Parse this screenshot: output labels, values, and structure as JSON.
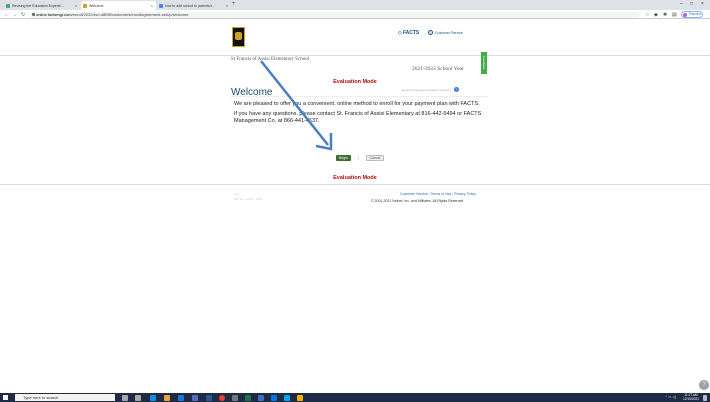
{
  "browser": {
    "tabs": [
      {
        "title": "Revising the Education Experie..."
      },
      {
        "title": "Welcome"
      },
      {
        "title": "how to add school to parents/r..."
      }
    ],
    "url_domain": "online.factsmgt.com",
    "url_path": "/enroll/2022/kw=d8f98/customers/enrollagreement-setup/welcome",
    "paused_label": "Paused"
  },
  "header": {
    "facts_brand": "FACTS",
    "customer_service": "Customer Service",
    "school_name": "St Francis of Assisi Elementary School",
    "school_year": "2021-2022 School Year",
    "feedback_label": "Feedback"
  },
  "main": {
    "eval_mode": "Evaluation Mode",
    "title": "Welcome",
    "help_text": "Need a language translation please?",
    "paragraph1": "We are pleased to offer you a convenient, online method to enroll for your payment plan with FACTS.",
    "paragraph2": "If you have any questions, please contact St. Francis of Assisi Elementary at 816-442-5494 or FACTS Management Co. at 866-441-4637.",
    "begin_label": "Begin",
    "cancel_label": "Cancel"
  },
  "footer": {
    "version1": "v.11",
    "version2": "DW 12-7-2021 / 2022",
    "links": [
      "Customer Service",
      "Terms of Use",
      "Privacy Policy"
    ],
    "copyright": "© 2001-2021 Nelnet, Inc. and Affiliates. All Rights Reserved."
  },
  "taskbar": {
    "search_placeholder": "Type here to search",
    "time": "11:17 AM",
    "date": "12/15/2021"
  },
  "colors": {
    "brand_blue": "#17506e",
    "eval_red": "#a11",
    "begin_green": "#3d6d35",
    "feedback_green": "#3cb043",
    "annotation_arrow": "#4a7fc1"
  }
}
